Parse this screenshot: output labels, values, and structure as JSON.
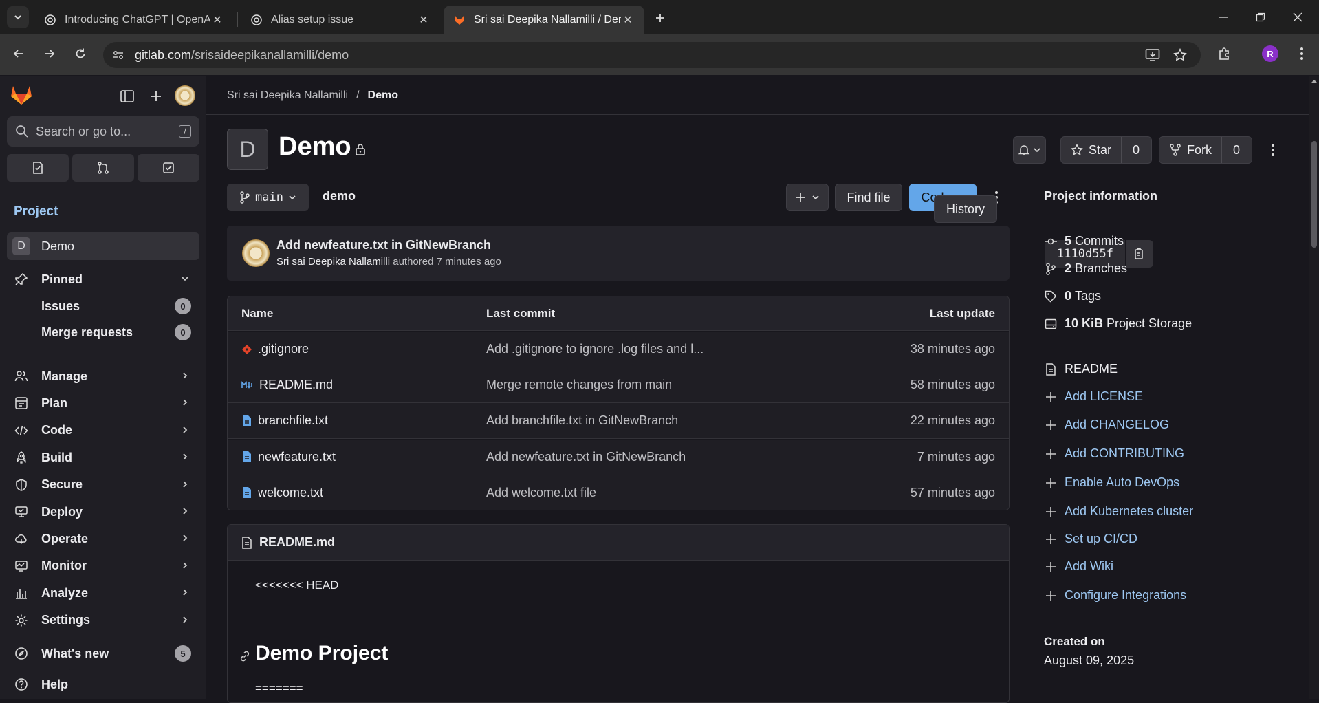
{
  "browser": {
    "tabs": [
      {
        "title": "Introducing ChatGPT | OpenAI",
        "icon": "openai-icon"
      },
      {
        "title": "Alias setup issue",
        "icon": "openai-icon"
      },
      {
        "title": "Sri sai Deepika Nallamilli / Demo",
        "icon": "gitlab-icon",
        "active": true
      }
    ],
    "url_host": "gitlab.com",
    "url_path": "/srisaideepikanallamilli/demo",
    "profile_initial": "R"
  },
  "sidebar": {
    "search_placeholder": "Search or go to...",
    "search_shortcut": "/",
    "section": "Project",
    "project_initial": "D",
    "project_name": "Demo",
    "pinned_label": "Pinned",
    "pinned": [
      {
        "label": "Issues",
        "count": "0"
      },
      {
        "label": "Merge requests",
        "count": "0"
      }
    ],
    "nav": [
      {
        "label": "Manage",
        "icon": "users-icon"
      },
      {
        "label": "Plan",
        "icon": "plan-icon"
      },
      {
        "label": "Code",
        "icon": "code-icon"
      },
      {
        "label": "Build",
        "icon": "rocket-icon"
      },
      {
        "label": "Secure",
        "icon": "shield-icon"
      },
      {
        "label": "Deploy",
        "icon": "deploy-icon"
      },
      {
        "label": "Operate",
        "icon": "cloud-icon"
      },
      {
        "label": "Monitor",
        "icon": "monitor-icon"
      },
      {
        "label": "Analyze",
        "icon": "chart-icon"
      },
      {
        "label": "Settings",
        "icon": "gear-icon"
      }
    ],
    "whats_new": "What's new",
    "whats_new_count": "5",
    "help": "Help"
  },
  "breadcrumb": {
    "owner": "Sri sai Deepika Nallamilli",
    "separator": "/",
    "project": "Demo"
  },
  "project": {
    "initial": "D",
    "title": "Demo",
    "star_label": "Star",
    "star_count": "0",
    "fork_label": "Fork",
    "fork_count": "0"
  },
  "repo": {
    "branch": "main",
    "path": "demo",
    "find_file": "Find file",
    "code_button": "Code",
    "last_commit": {
      "title": "Add newfeature.txt in GitNewBranch",
      "author": "Sri sai Deepika Nallamilli",
      "authored_text": "authored 7 minutes ago",
      "sha": "1110d55f",
      "history": "History"
    },
    "table_headers": {
      "name": "Name",
      "last_commit": "Last commit",
      "last_update": "Last update"
    },
    "files": [
      {
        "name": ".gitignore",
        "icon": "git-icon",
        "commit": "Add .gitignore to ignore .log files and l...",
        "updated": "38 minutes ago"
      },
      {
        "name": "README.md",
        "icon": "markdown-icon",
        "commit": "Merge remote changes from main",
        "updated": "58 minutes ago"
      },
      {
        "name": "branchfile.txt",
        "icon": "file-icon",
        "commit": "Add branchfile.txt in GitNewBranch",
        "updated": "22 minutes ago"
      },
      {
        "name": "newfeature.txt",
        "icon": "file-icon",
        "commit": "Add newfeature.txt in GitNewBranch",
        "updated": "7 minutes ago"
      },
      {
        "name": "welcome.txt",
        "icon": "file-icon",
        "commit": "Add welcome.txt file",
        "updated": "57 minutes ago"
      }
    ]
  },
  "readme": {
    "filename": "README.md",
    "line1": "<<<<<<< HEAD",
    "heading": "Demo Project",
    "line2": "======="
  },
  "info": {
    "title": "Project information",
    "commits_count": "5",
    "commits_label": "Commits",
    "branches_count": "2",
    "branches_label": "Branches",
    "tags_count": "0",
    "tags_label": "Tags",
    "storage_size": "10 KiB",
    "storage_label": "Project Storage",
    "readme_label": "README",
    "links": [
      "Add LICENSE",
      "Add CHANGELOG",
      "Add CONTRIBUTING",
      "Enable Auto DevOps",
      "Add Kubernetes cluster",
      "Set up CI/CD",
      "Add Wiki",
      "Configure Integrations"
    ],
    "created_label": "Created on",
    "created_date": "August 09, 2025"
  },
  "colors": {
    "accent_link": "#9dc7f1",
    "code_button": "#63a6e9",
    "gitlab_orange": "#fc6d26"
  }
}
